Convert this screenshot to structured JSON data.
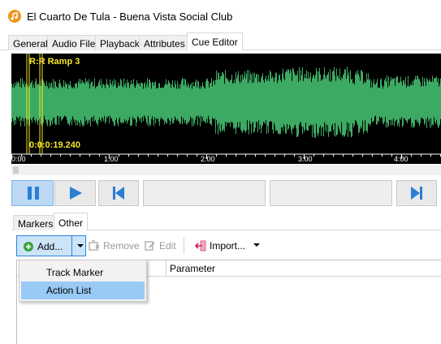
{
  "window": {
    "title": "El Cuarto De Tula - Buena Vista Social Club",
    "icon": "app-logo-icon"
  },
  "tabs": [
    {
      "label": "General",
      "active": false
    },
    {
      "label": "Audio File",
      "active": false
    },
    {
      "label": "Playback",
      "active": false
    },
    {
      "label": "Attributes",
      "active": false
    },
    {
      "label": "Cue Editor",
      "active": true
    }
  ],
  "waveform": {
    "marker_label": "R:R Ramp 3",
    "position_label": "0:0:0:19.240",
    "ticks": [
      "0:00",
      "1:00",
      "2:00",
      "3:00",
      "4:00"
    ],
    "wave_color": "#3daa63",
    "marker_color": "#f5e52a"
  },
  "transport": {
    "pause_icon": "pause-icon",
    "play_icon": "play-icon",
    "previous_icon": "skip-to-start-icon",
    "next_icon": "skip-to-end-icon",
    "accent_color": "#2a7fd4"
  },
  "subtabs": [
    {
      "label": "Markers",
      "active": false
    },
    {
      "label": "Other",
      "active": true
    }
  ],
  "toolbar": {
    "add_label": "Add...",
    "remove_label": "Remove",
    "edit_label": "Edit",
    "import_label": "Import..."
  },
  "list": {
    "columns": [
      "",
      "Parameter"
    ]
  },
  "dropdown": {
    "items": [
      {
        "label": "Track Marker",
        "selected": false
      },
      {
        "label": "Action List",
        "selected": true
      }
    ]
  }
}
